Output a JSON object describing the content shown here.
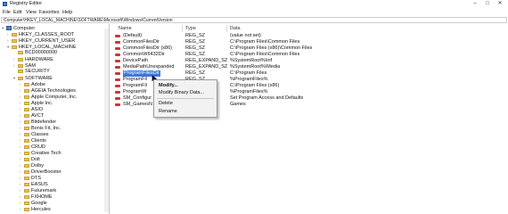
{
  "window": {
    "title": "Registry Editor",
    "minimize": "–",
    "maximize": "□",
    "close": "✕"
  },
  "menu": [
    "File",
    "Edit",
    "View",
    "Favorites",
    "Help"
  ],
  "address": "Computer\\HKEY_LOCAL_MACHINE\\SOFTWARE\\Microsoft\\Windows\\CurrentVersion",
  "tree": {
    "root": "Computer",
    "hives": [
      "HKEY_CLASSES_ROOT",
      "HKEY_CURRENT_USER",
      "HKEY_LOCAL_MACHINE"
    ],
    "hklm_children": [
      "BCD00000000",
      "HARDWARE",
      "SAM",
      "SECURITY",
      "SOFTWARE"
    ],
    "software_children": [
      "Adobe",
      "AGEIA Technologies",
      "Apple Computer, Inc.",
      "Apple Inc.",
      "ASIO",
      "AVCT",
      "Bitdefender",
      "Bonis Fit, Inc.",
      "Classes",
      "Clients",
      "CRUD",
      "Creative Tech",
      "Dolt",
      "Dolby",
      "DriverBooster",
      "DTS",
      "EASUS",
      "Futuremark",
      "FXHOME",
      "Google",
      "Hercules"
    ]
  },
  "columns": {
    "name": "Name",
    "type": "Type",
    "data": "Data"
  },
  "rows": [
    {
      "name": "(Default)",
      "type": "REG_SZ",
      "data": "(value not set)"
    },
    {
      "name": "CommonFilesDir",
      "type": "REG_SZ",
      "data": "C:\\Program Files\\Common Files"
    },
    {
      "name": "CommonFilesDir (x86)",
      "type": "REG_SZ",
      "data": "C:\\Program Files (x86)\\Common Files"
    },
    {
      "name": "CommonW6432Dir",
      "type": "REG_SZ",
      "data": "C:\\Program Files\\Common Files"
    },
    {
      "name": "DevicePath",
      "type": "REG_EXPAND_SZ",
      "data": "%SystemRoot%\\inf"
    },
    {
      "name": "MediaPathUnexpanded",
      "type": "REG_EXPAND_SZ",
      "data": "%SystemRoot%\\Media"
    },
    {
      "name": "ProgramFilesDir",
      "type": "REG_SZ",
      "data": "C:\\Program Files"
    },
    {
      "name": "ProgramFil",
      "type": "REG_SZ",
      "data": "%ProgramFiles%"
    },
    {
      "name": "ProgramFil",
      "type": "REG_SZ",
      "data": "C:\\Program Files (x86)"
    },
    {
      "name": "ProgramW",
      "type": "REG_SZ",
      "data": "%ProgramFiles%"
    },
    {
      "name": "SM_Configur",
      "type": "REG_SZ",
      "data": "Set Program Access and Defaults"
    },
    {
      "name": "SM_GamesN",
      "type": "REG_SZ",
      "data": "Games"
    }
  ],
  "context_menu": [
    "Modify...",
    "Modify Binary Data...",
    "Delete",
    "Rename"
  ]
}
